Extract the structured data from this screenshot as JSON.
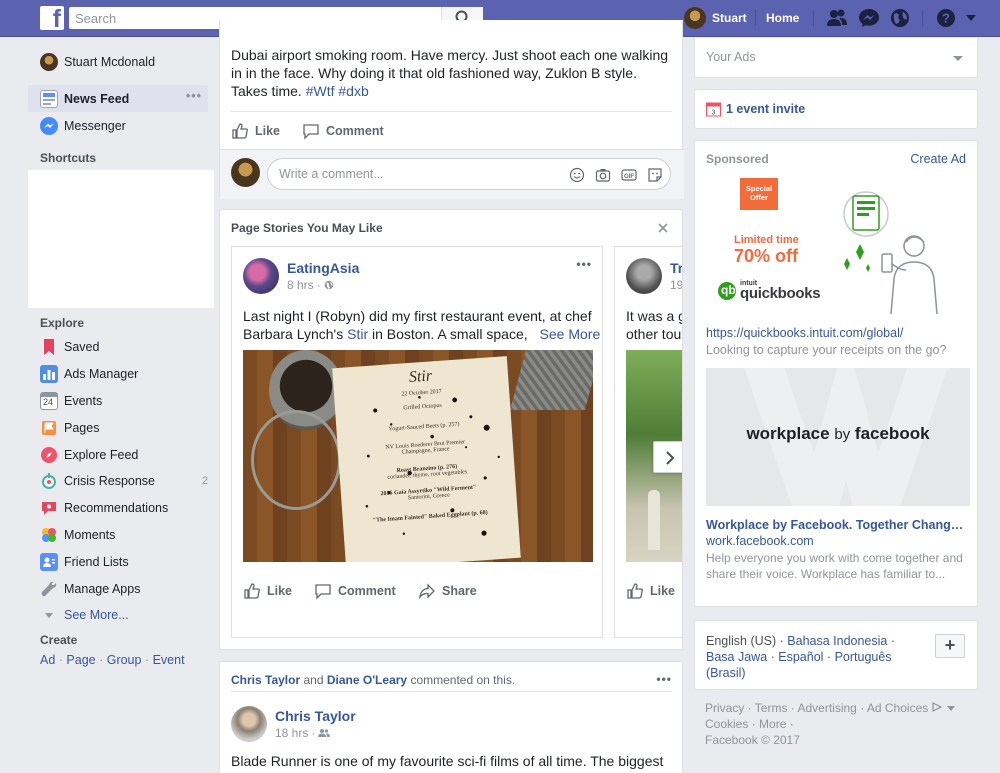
{
  "topbar": {
    "search_placeholder": "Search",
    "user_name": "Stuart",
    "home_label": "Home"
  },
  "leftnav": {
    "profile_name": "Stuart Mcdonald",
    "news_feed": "News Feed",
    "messenger": "Messenger",
    "shortcuts_heading": "Shortcuts",
    "explore_heading": "Explore",
    "explore_items": [
      {
        "label": "Saved",
        "icon": "bookmark-icon",
        "color": "#e4405f"
      },
      {
        "label": "Ads Manager",
        "icon": "bar-chart-icon",
        "color": "#4f8ee6"
      },
      {
        "label": "Events",
        "icon": "calendar-icon",
        "color": "#8d949e"
      },
      {
        "label": "Pages",
        "icon": "flag-icon",
        "color": "#f5913c"
      },
      {
        "label": "Explore Feed",
        "icon": "rocket-icon",
        "color": "#f25268"
      },
      {
        "label": "Crisis Response",
        "icon": "crisis-icon",
        "color": "#3fb79e"
      },
      {
        "label": "Recommendations",
        "icon": "recommendation-icon",
        "color": "#e04860"
      },
      {
        "label": "Moments",
        "icon": "moments-icon",
        "color": "#f7b928"
      },
      {
        "label": "Friend Lists",
        "icon": "friend-list-icon",
        "color": "#5890ff"
      },
      {
        "label": "Manage Apps",
        "icon": "wrench-icon",
        "color": "#8d949e"
      }
    ],
    "crisis_count": "2",
    "see_more": "See More...",
    "create_heading": "Create",
    "create_links": [
      "Ad",
      "Page",
      "Group",
      "Event"
    ]
  },
  "feed": {
    "post1": {
      "text": "Dubai airport smoking room. Have mercy. Just shoot each one walking in in the face. Why doing it that old fashioned way, Zuklon B style. Takes time.",
      "hashtags": "#Wtf #dxb",
      "like": "Like",
      "comment": "Comment",
      "comment_placeholder": "Write a comment..."
    },
    "page_stories": {
      "title": "Page Stories You May Like",
      "story1": {
        "page_name": "EatingAsia",
        "time": "8 hrs",
        "text_line1": "Last night I (Robyn) did my first restaurant event, at chef",
        "text_line2_pre": "Barbara Lynch's",
        "text_link": "Stir",
        "text_line2_post": "in Boston. A small space,",
        "see_more": "See More",
        "menu_lines": [
          "Stir",
          "22 October 2017",
          "Grilled Octopus",
          "Yogurt-Sauced Beets (p. 257)",
          "NV Louis Roederer Brut Premier",
          "Champagne, France",
          "Roast Branzino (p. 276)",
          "coriander, thyme, root vegetables",
          "2016 Gaia Assyrtiko \"Wild Ferment\"",
          "Santorini, Greece",
          "\"The Imam Fainted\" Baked Eggplant (p. 68)"
        ],
        "like": "Like",
        "comment": "Comment",
        "share": "Share"
      },
      "story2": {
        "page_name": "Tr",
        "time": "19",
        "text_line1": "It was a g",
        "text_line2": "other tour",
        "like": "Like"
      }
    },
    "post2": {
      "header_name1": "Chris Taylor",
      "header_and": "and",
      "header_name2": "Diane O'Leary",
      "header_suffix": "commented on this.",
      "author": "Chris Taylor",
      "time": "18 hrs",
      "text": "Blade Runner is one of my favourite sci-fi films of all time. The biggest"
    }
  },
  "rightcol": {
    "your_ads": "Your Ads",
    "event_invite": "1 event invite",
    "sponsored": "Sponsored",
    "create_ad": "Create Ad",
    "ad1": {
      "badge_line1": "Special",
      "badge_line2": "Offer",
      "promo_line1": "Limited time",
      "promo_line2": "70% off",
      "brand_small": "intuit",
      "brand": "quickbooks",
      "url": "https://quickbooks.intuit.com/global/",
      "desc": "Looking to capture your receipts on the go?"
    },
    "ad2": {
      "logo_word1": "workplace",
      "logo_word2": "by",
      "logo_word3": "facebook",
      "title": "Workplace by Facebook. Together Change...",
      "domain": "work.facebook.com",
      "desc": "Help everyone you work with come together and share their voice. Workplace has familiar to..."
    },
    "languages": {
      "current": "English (US)",
      "others": [
        "Bahasa Indonesia",
        "Basa Jawa",
        "Español",
        "Português (Brasil)"
      ],
      "plus": "+"
    },
    "footer": {
      "links": [
        "Privacy",
        "Terms",
        "Advertising",
        "Ad Choices",
        "Cookies",
        "More"
      ],
      "copyright": "Facebook © 2017"
    }
  }
}
